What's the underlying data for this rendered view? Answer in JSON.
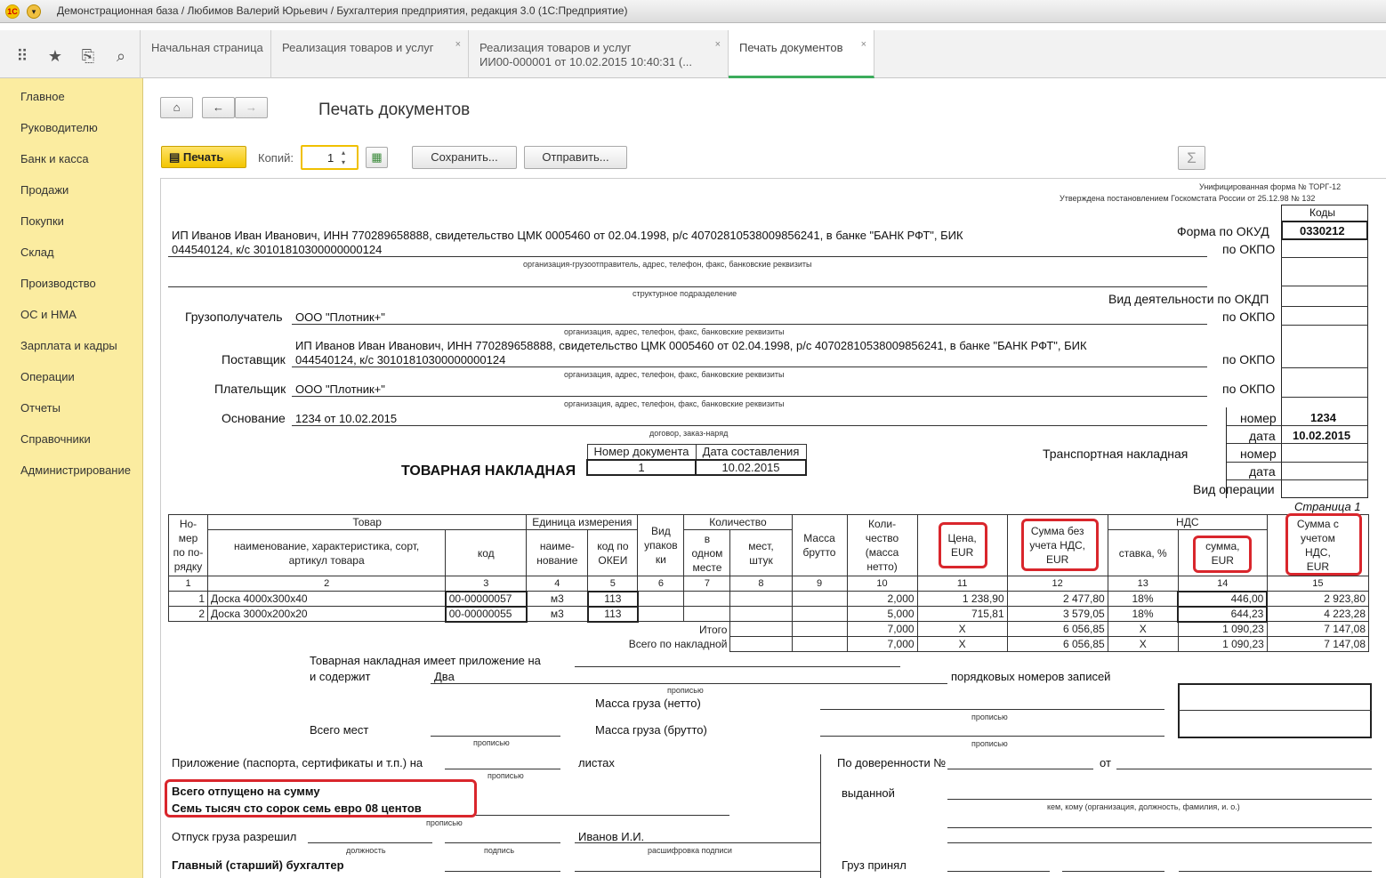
{
  "window": {
    "title": "Демонстрационная база / Любимов Валерий Юрьевич / Бухгалтерия предприятия, редакция 3.0  (1С:Предприятие)",
    "logo": "1С"
  },
  "tabs": [
    {
      "label": "Начальная страница"
    },
    {
      "label": "Реализация товаров и услуг"
    },
    {
      "label": "Реализация товаров и услуг",
      "label2": "ИИ00-000001 от 10.02.2015 10:40:31 (..."
    },
    {
      "label": "Печать документов"
    }
  ],
  "sidebar": {
    "items": [
      "Главное",
      "Руководителю",
      "Банк и касса",
      "Продажи",
      "Покупки",
      "Склад",
      "Производство",
      "ОС и НМА",
      "Зарплата и кадры",
      "Операции",
      "Отчеты",
      "Справочники",
      "Администрирование"
    ]
  },
  "page": {
    "title": "Печать документов"
  },
  "toolbar": {
    "print": "Печать",
    "copies_label": "Копий:",
    "copies_value": "1",
    "save": "Сохранить...",
    "send": "Отправить..."
  },
  "doc": {
    "form_line1": "Унифицированная форма № ТОРГ-12",
    "form_line2": "Утверждена постановлением Госкомстата России от 25.12.98 № 132",
    "codes": "Коды",
    "okud_label": "Форма по ОКУД",
    "okud": "0330212",
    "okpo": "по ОКПО",
    "okdp": "Вид деятельности по ОКДП",
    "sender_l1": "ИП Иванов Иван Иванович, ИНН 770289658888, свидетельство ЦМК 0005460 от 02.04.1998, р/с 40702810538009856241, в банке \"БАНК РФТ\", БИК",
    "sender_l2": "044540124, к/с 30101810300000000124",
    "sender_cap": "организация-грузоотправитель, адрес, телефон, факс, банковские реквизиты",
    "struct_cap": "структурное подразделение",
    "consignee_label": "Грузополучатель",
    "consignee": "ООО \"Плотник+\"",
    "org_cap": "организация, адрес, телефон, факс, банковские реквизиты",
    "supplier_label": "Поставщик",
    "payer_label": "Плательщик",
    "payer": "ООО \"Плотник+\"",
    "basis_label": "Основание",
    "basis": "1234 от 10.02.2015",
    "basis_cap": "договор, заказ-наряд",
    "num_label": "номер",
    "num_val": "1234",
    "date_label": "дата",
    "date_val": "10.02.2015",
    "transport": "Транспортная накладная",
    "vid_op": "Вид операции",
    "page_label": "Страница 1",
    "docnum_h": "Номер документа",
    "docdate_h": "Дата составления",
    "docnum": "1",
    "docdate": "10.02.2015",
    "title": "ТОВАРНАЯ НАКЛАДНАЯ"
  },
  "table": {
    "h_no": [
      "Но-",
      "мер",
      "по по-",
      "рядку"
    ],
    "h_goods": "Товар",
    "h_name": [
      "наименование, характеристика, сорт,",
      "артикул товара"
    ],
    "h_code": "код",
    "h_unit": "Единица измерения",
    "h_uname": [
      "наиме-",
      "нование"
    ],
    "h_okei": [
      "код по",
      "ОКЕИ"
    ],
    "h_pack": [
      "Вид",
      "упаков",
      "ки"
    ],
    "h_qty": "Количество",
    "h_one": [
      "в",
      "одном",
      "месте"
    ],
    "h_places": [
      "мест,",
      "штук"
    ],
    "h_brutto": [
      "Масса",
      "брутто"
    ],
    "h_netto": [
      "Коли-",
      "чество",
      "(масса",
      "нетто)"
    ],
    "h_price": [
      "Цена,",
      "EUR"
    ],
    "h_sumnovat": [
      "Сумма без",
      "учета НДС,",
      "EUR"
    ],
    "h_vat": "НДС",
    "h_rate": "ставка, %",
    "h_vatsum": [
      "сумма,",
      "EUR"
    ],
    "h_total": [
      "Сумма с",
      "учетом",
      "НДС,",
      "EUR"
    ],
    "nums": [
      "1",
      "2",
      "3",
      "4",
      "5",
      "6",
      "7",
      "8",
      "9",
      "10",
      "11",
      "12",
      "13",
      "14",
      "15"
    ],
    "rows": [
      {
        "no": "1",
        "name": "Доска 4000х300х40",
        "code": "00-00000057",
        "unit": "м3",
        "okei": "113",
        "qty": "2,000",
        "price": "1 238,90",
        "sum": "2 477,80",
        "rate": "18%",
        "vat": "446,00",
        "total": "2 923,80"
      },
      {
        "no": "2",
        "name": "Доска 3000х200х20",
        "code": "00-00000055",
        "unit": "м3",
        "okei": "113",
        "qty": "5,000",
        "price": "715,81",
        "sum": "3 579,05",
        "rate": "18%",
        "vat": "644,23",
        "total": "4 223,28"
      }
    ],
    "itogo_label": "Итого",
    "itogo": {
      "qty": "7,000",
      "x": "X",
      "sum": "6 056,85",
      "vat": "1 090,23",
      "total": "7 147,08"
    },
    "vsego_label": "Всего по накладной",
    "vsego": {
      "qty": "7,000",
      "x": "X",
      "sum": "6 056,85",
      "vat": "1 090,23",
      "total": "7 147,08"
    }
  },
  "footer": {
    "attach": "Товарная накладная имеет приложение на",
    "contains": "и содержит",
    "contains_val": "Два",
    "records": "порядковых номеров записей",
    "propisyu": "прописью",
    "mass_netto": "Масса груза (нетто)",
    "mass_brutto": "Масса груза (брутто)",
    "places": "Всего мест",
    "appendix": "Приложение (паспорта, сертификаты и т.п.) на",
    "sheets": "листах",
    "total1": "Всего отпущено  на сумму",
    "total2": "Семь тысяч сто сорок семь евро 08 центов",
    "release": "Отпуск груза разрешил",
    "position": "должность",
    "signature": "подпись",
    "decode": "расшифровка подписи",
    "ivanov": "Иванов И.И.",
    "chief": "Главный (старший) бухгалтер",
    "proxy": "По доверенности №",
    "from": "от",
    "issued": "выданной",
    "whom": "кем, кому (организация, должность, фамилия, и. о.)",
    "received": "Груз принял"
  }
}
